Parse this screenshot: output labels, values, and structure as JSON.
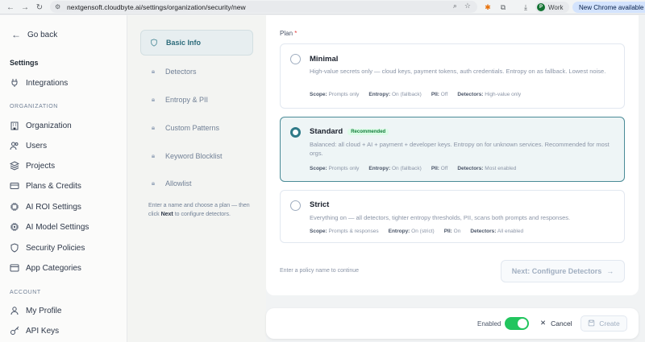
{
  "browser": {
    "url": "nextgensoft.cloudbyte.ai/settings/organization/security/new",
    "profile_name": "Work",
    "profile_initial": "P",
    "update_label": "New Chrome available"
  },
  "sidebar": {
    "back_label": "Go back",
    "heading": "Settings",
    "integrations": "Integrations",
    "org_section": "ORGANIZATION",
    "org_items": [
      "Organization",
      "Users",
      "Projects",
      "Plans & Credits",
      "AI ROI Settings",
      "AI Model Settings",
      "Security Policies",
      "App Categories"
    ],
    "account_section": "ACCOUNT",
    "account_items": [
      "My Profile",
      "API Keys"
    ]
  },
  "steps": {
    "items": [
      "Basic Info",
      "Detectors",
      "Entropy & PII",
      "Custom Patterns",
      "Keyword Blocklist",
      "Allowlist"
    ],
    "hint_before": "Enter a name and choose a plan — then click ",
    "hint_bold": "Next",
    "hint_after": " to configure detectors."
  },
  "plan": {
    "label": "Plan",
    "required_mark": "*",
    "cards": [
      {
        "name": "Minimal",
        "badge": "",
        "desc": "High-value secrets only — cloud keys, payment tokens, auth credentials. Entropy on as fallback. Lowest noise.",
        "scope_k": "Scope:",
        "scope_v": "Prompts only",
        "entropy_k": "Entropy:",
        "entropy_v": "On (fallback)",
        "pii_k": "PII:",
        "pii_v": "Off",
        "det_k": "Detectors:",
        "det_v": "High-value only"
      },
      {
        "name": "Standard",
        "badge": "Recommended",
        "desc": "Balanced: all cloud + AI + payment + developer keys. Entropy on for unknown services. Recommended for most orgs.",
        "scope_k": "Scope:",
        "scope_v": "Prompts only",
        "entropy_k": "Entropy:",
        "entropy_v": "On (fallback)",
        "pii_k": "PII:",
        "pii_v": "Off",
        "det_k": "Detectors:",
        "det_v": "Most enabled"
      },
      {
        "name": "Strict",
        "badge": "",
        "desc": "Everything on — all detectors, tighter entropy thresholds, PII, scans both prompts and responses.",
        "scope_k": "Scope:",
        "scope_v": "Prompts & responses",
        "entropy_k": "Entropy:",
        "entropy_v": "On (strict)",
        "pii_k": "PII:",
        "pii_v": "On",
        "det_k": "Detectors:",
        "det_v": "All enabled"
      }
    ],
    "footer_hint": "Enter a policy name to continue",
    "next_label": "Next: Configure Detectors"
  },
  "bottom": {
    "enabled_label": "Enabled",
    "enabled": true,
    "cancel_label": "Cancel",
    "create_label": "Create"
  },
  "colors": {
    "accent": "#2f7a88",
    "toggle_on": "#22c55e",
    "badge_bg": "#dcfce7",
    "badge_text": "#15803d"
  }
}
